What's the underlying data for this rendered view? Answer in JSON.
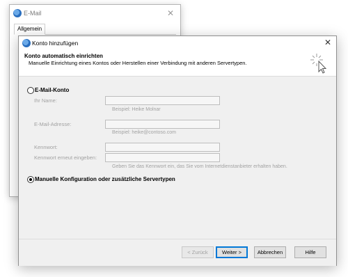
{
  "back_window": {
    "title": "E-Mail",
    "tab": "Allgemein"
  },
  "dialog": {
    "title": "Konto hinzufügen",
    "header_title": "Konto automatisch einrichten",
    "header_subtitle": "Manuelle Einrichtung eines Kontos oder Herstellen einer Verbindung mit anderen Servertypen.",
    "email_option": {
      "label": "E-Mail-Konto",
      "selected": false,
      "name_label": "Ihr Name:",
      "name_value": "",
      "name_hint": "Beispiel: Heike Molnar",
      "email_label": "E-Mail-Adresse:",
      "email_value": "",
      "email_hint": "Beispiel: heike@contoso.com",
      "password_label": "Kennwort:",
      "password_value": "",
      "password_repeat_label": "Kennwort erneut eingeben:",
      "password_repeat_value": "",
      "password_hint": "Geben Sie das Kennwort ein, das Sie vom Internetdienstanbieter erhalten haben."
    },
    "manual_option": {
      "label": "Manuelle Konfiguration oder zusätzliche Servertypen",
      "selected": true
    },
    "buttons": {
      "back": "< Zurück",
      "next": "Weiter >",
      "cancel": "Abbrechen",
      "help": "Hilfe"
    }
  },
  "icons": {
    "app": "outlook-mail-icon",
    "close": "close-icon",
    "wizard": "wizard-cursor-sparkle-icon"
  }
}
